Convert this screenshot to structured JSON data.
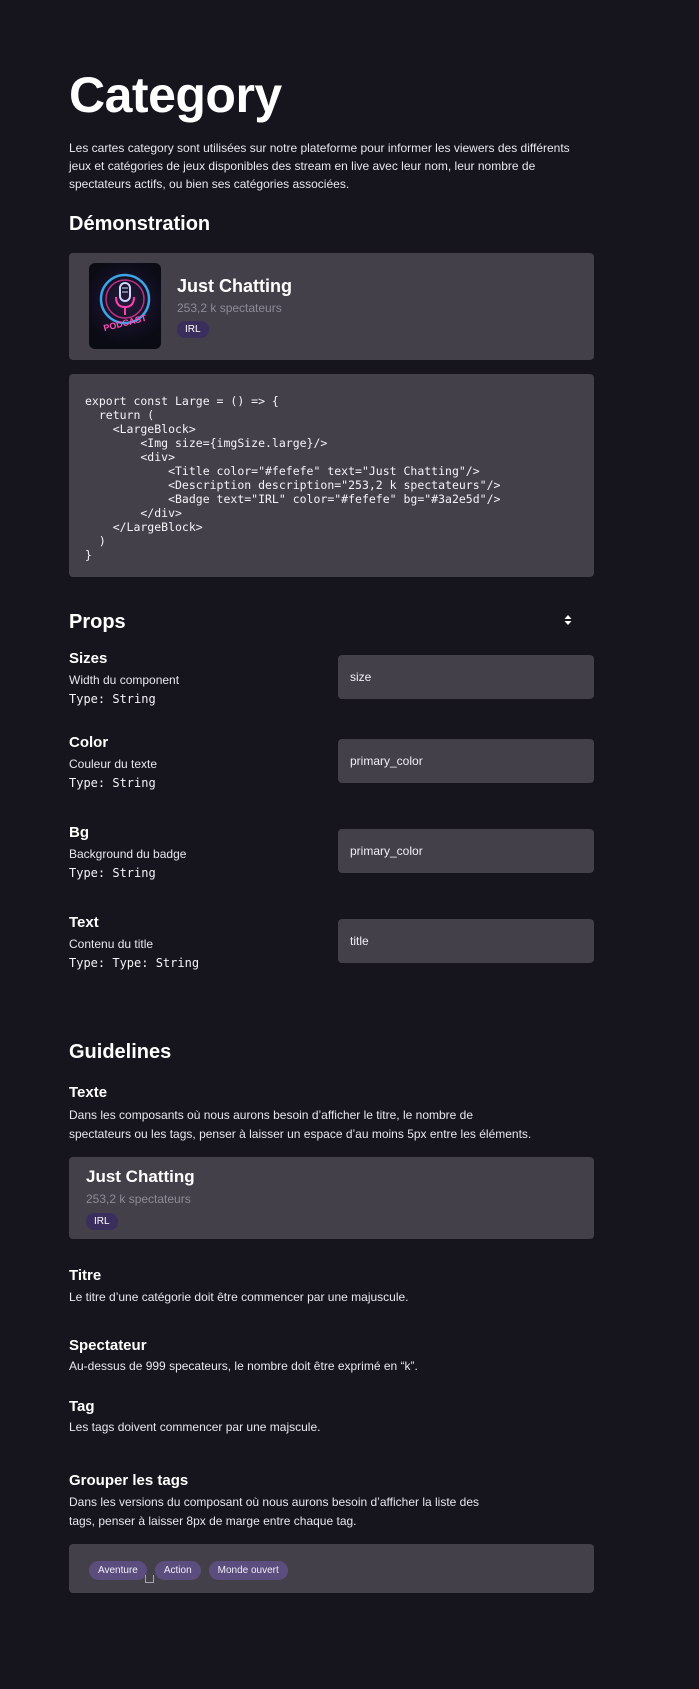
{
  "header": {
    "title": "Category",
    "intro": "Les cartes category sont utilisées sur notre plateforme pour informer les viewers des différents jeux et catégories de jeux disponibles des stream en live avec leur nom, leur nombre de spectateurs actifs, ou bien ses catégories associées."
  },
  "demo": {
    "heading": "Démonstration",
    "card": {
      "title": "Just Chatting",
      "description": "253,2  k spectateurs",
      "badge": "IRL",
      "thumbnail_text": "PODCAST",
      "thumbnail_icon": "microphone-icon"
    },
    "code_lines": [
      "export const Large = () => {",
      "  return (",
      "    <LargeBlock>",
      "        <Img size={imgSize.large}/>",
      "        <div>",
      "            <Title color=\"#fefefe\" text=\"Just Chatting\"/>",
      "            <Description description=\"253,2 k spectateurs\"/>",
      "            <Badge text=\"IRL\" color=\"#fefefe\" bg=\"#3a2e5d\"/>",
      "        </div>",
      "    </LargeBlock>",
      "  )",
      "}"
    ]
  },
  "props": {
    "heading": "Props",
    "sort_icon": "sort-icon",
    "items": [
      {
        "name": "Sizes",
        "description": "Width du component",
        "type": "Type: String",
        "value": "size"
      },
      {
        "name": "Color",
        "description": "Couleur du texte",
        "type": "Type: String",
        "value": "primary_color"
      },
      {
        "name": "Bg",
        "description": "Background du badge",
        "type": "Type: String",
        "value": "primary_color"
      },
      {
        "name": "Text",
        "description": "Contenu du title",
        "type": "Type: Type: String",
        "value": "title"
      }
    ]
  },
  "guidelines": {
    "heading": "Guidelines",
    "texte": {
      "title": "Texte",
      "line1": "Dans les composants où nous aurons besoin d’afficher le titre, le nombre de",
      "line2": "spectateurs ou les tags, penser à laisser un espace d’au moins 5px entre les éléments.",
      "card": {
        "title": "Just Chatting",
        "description": "253,2  k spectateurs",
        "badge": "IRL"
      }
    },
    "titre": {
      "title": "Titre",
      "text": "Le titre d’une catégorie doit être commencer par une majuscule."
    },
    "spectateur": {
      "title": "Spectateur",
      "text": "Au-dessus de 999 specateurs, le nombre doit être exprimé en “k”."
    },
    "tag": {
      "title": "Tag",
      "text": "Les tags doivent commencer par une majscule."
    },
    "grouper": {
      "title": "Grouper les tags",
      "line1": "Dans les versions du composant où nous aurons besoin d’afficher la liste des",
      "line2": "tags, penser à laisser 8px de marge entre chaque tag.",
      "tags": [
        "Aventure",
        "Action",
        "Monde ouvert"
      ]
    }
  },
  "colors": {
    "background": "#16141c",
    "panel": "#44404a",
    "badge_bg": "#3a2e5d",
    "tag_bg": "#5b4d7d",
    "text_light": "#fefefe"
  }
}
